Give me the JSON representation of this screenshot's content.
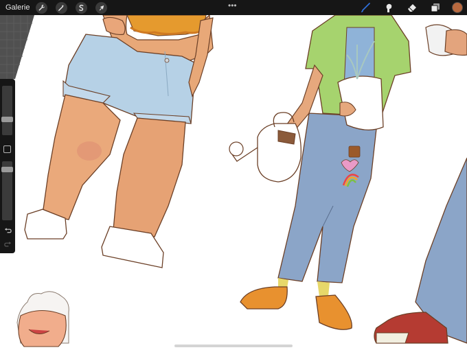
{
  "app": {
    "gallery_label": "Galerie"
  },
  "toolbar_left": [
    {
      "name": "adjustments",
      "icon": "wrench-icon"
    },
    {
      "name": "magic",
      "icon": "magic-wand-icon"
    },
    {
      "name": "selection",
      "icon": "selection-s-icon"
    },
    {
      "name": "transform",
      "icon": "arrow-cursor-icon"
    }
  ],
  "toolbar_center": {
    "more_label": "•••"
  },
  "toolbar_right": [
    {
      "name": "brush",
      "icon": "brush-icon",
      "active_color": "#2f6fd9"
    },
    {
      "name": "smudge",
      "icon": "smudge-icon"
    },
    {
      "name": "eraser",
      "icon": "eraser-icon"
    },
    {
      "name": "layers",
      "icon": "layers-icon"
    }
  ],
  "current_color": "#b8693f",
  "sidebar": {
    "brush_size": 0.3,
    "opacity": 0.9
  },
  "colors": {
    "bar": "#161616",
    "canvas": "#ffffff"
  }
}
